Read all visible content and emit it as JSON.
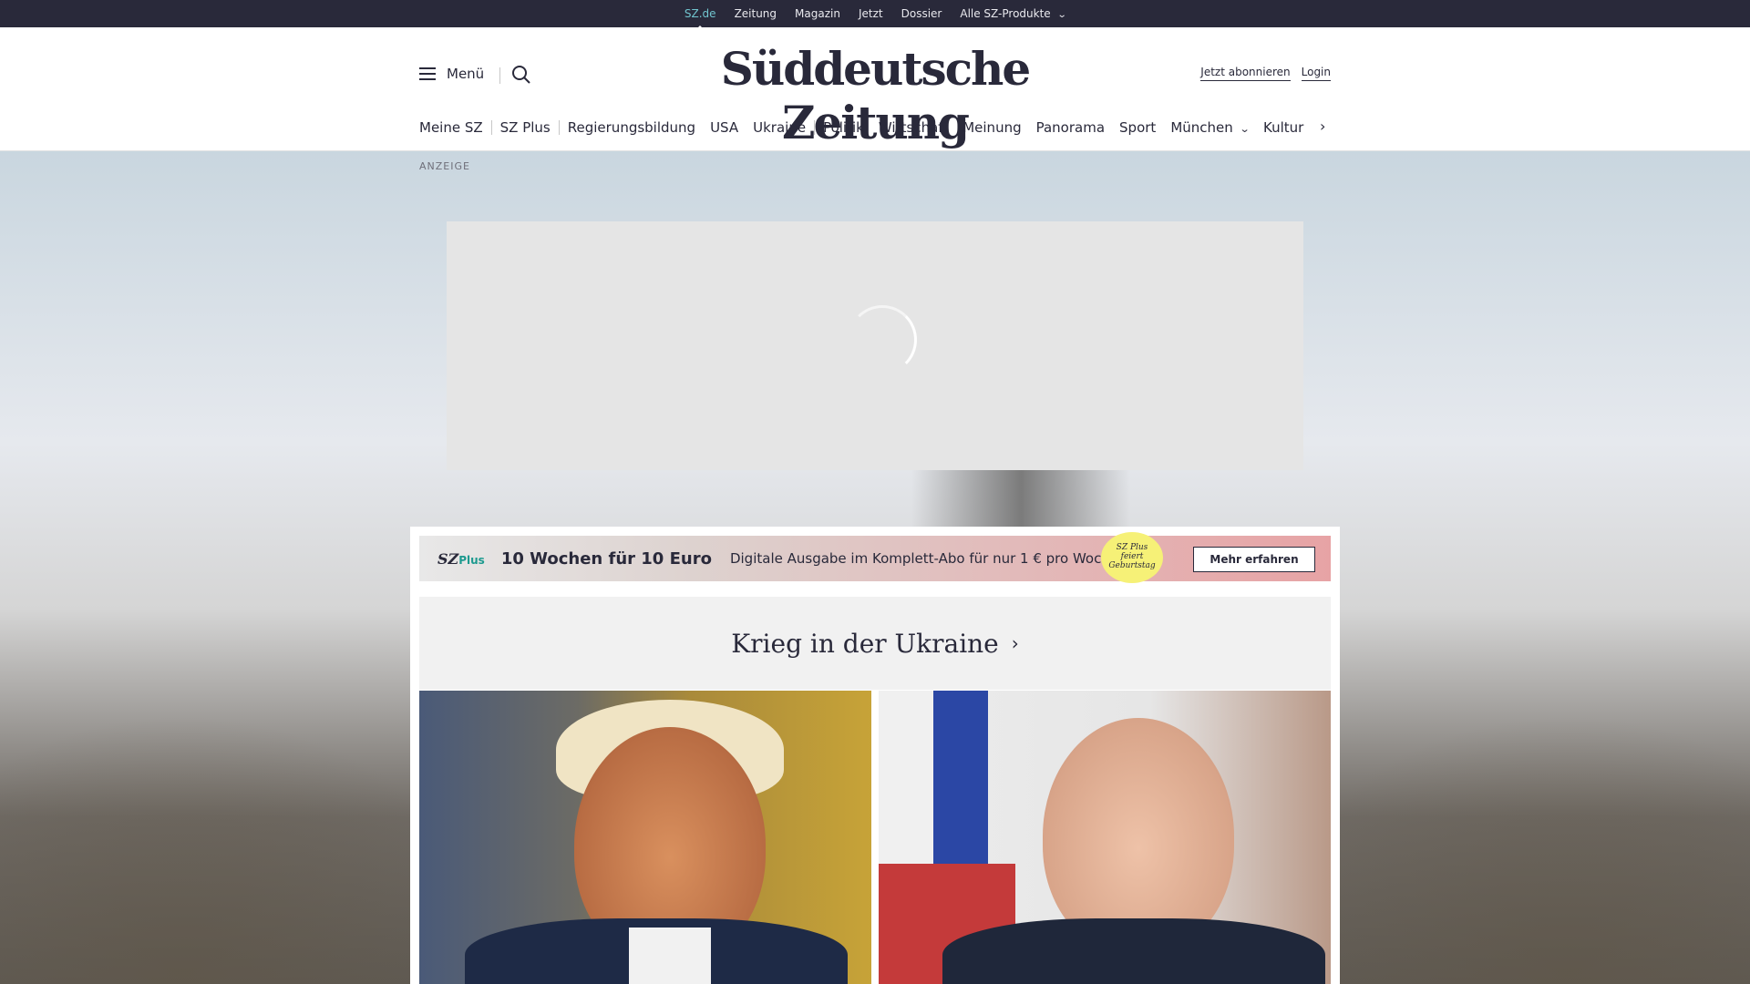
{
  "topbar": {
    "items": [
      "SZ.de",
      "Zeitung",
      "Magazin",
      "Jetzt",
      "Dossier",
      "Alle SZ-Produkte"
    ],
    "active_color": "#71c5cf",
    "background": "#29293a"
  },
  "header": {
    "menu_label": "Menü",
    "logo": "Süddeutsche Zeitung",
    "subscribe_label": "Jetzt abonnieren",
    "login_label": "Login"
  },
  "nav": {
    "items": [
      "Meine SZ",
      "SZ Plus",
      "Regierungsbildung",
      "USA",
      "Ukraine",
      "Politik",
      "Wirtschaft",
      "Meinung",
      "Panorama",
      "Sport",
      "München",
      "Kultur"
    ]
  },
  "ad": {
    "label": "ANZEIGE"
  },
  "promo": {
    "brand": "SZ",
    "brand_plus": "Plus",
    "headline": "10 Wochen für 10 Euro",
    "text": "Digitale Ausgabe im Komplett-Abo für nur 1 € pro Woche.",
    "badge_lines": [
      "SZ Plus",
      "feiert",
      "Geburtstag"
    ],
    "cta": "Mehr erfahren"
  },
  "section": {
    "title": "Krieg in der Ukraine"
  },
  "icons": {
    "menu": "hamburger-icon",
    "search": "search-icon",
    "chevron": "chevron-down-icon",
    "arrow": "chevron-right-icon"
  }
}
